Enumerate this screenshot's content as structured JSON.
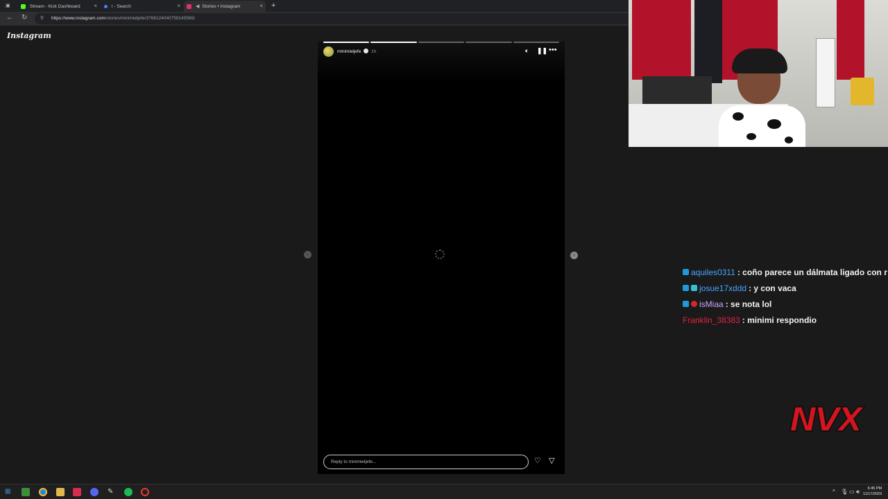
{
  "browser": {
    "tabs": [
      {
        "title": "Stream - Kick Dashboard",
        "favicon_color": "#53fc18"
      },
      {
        "title": "l - Search",
        "favicon_color": "#4285f4"
      },
      {
        "title": "Stories • Instagram",
        "favicon_color": "#e1306c"
      }
    ],
    "new_tab_label": "+",
    "url_host": "https://www.instagram.com",
    "url_path": "/stories/minimieljefe/3768124040759145565/"
  },
  "instagram": {
    "logo_text": "Instagram",
    "story": {
      "username": "minimieljefe",
      "time_ago": "1h",
      "progress_segments_total": 5,
      "progress_segments_done": 2,
      "reply_placeholder": "Reply to minimieljefe..."
    }
  },
  "chat": {
    "messages": [
      {
        "user": "aquiles0311",
        "text": ": coño parece un dálmata ligado con r",
        "user_color": "#4aa3ff",
        "badges": [
          "#1e9bd7"
        ]
      },
      {
        "user": "josue17xddd",
        "text": ": y con vaca",
        "user_color": "#4aa3ff",
        "badges": [
          "#1e9bd7",
          "#37c0d0"
        ]
      },
      {
        "user": "isMiaa",
        "text": ": se nota lol",
        "user_color": "#c9a8ff",
        "badges": [
          "#1e9bd7",
          "#d0282d"
        ]
      },
      {
        "user": "Franklin_38383",
        "text": ": minimi respondio",
        "user_color": "#e5233f",
        "badges": []
      }
    ]
  },
  "overlay": {
    "logo_text": "NVX"
  },
  "taskbar": {
    "time": "6:45 PM",
    "date": "11/17/2023"
  }
}
